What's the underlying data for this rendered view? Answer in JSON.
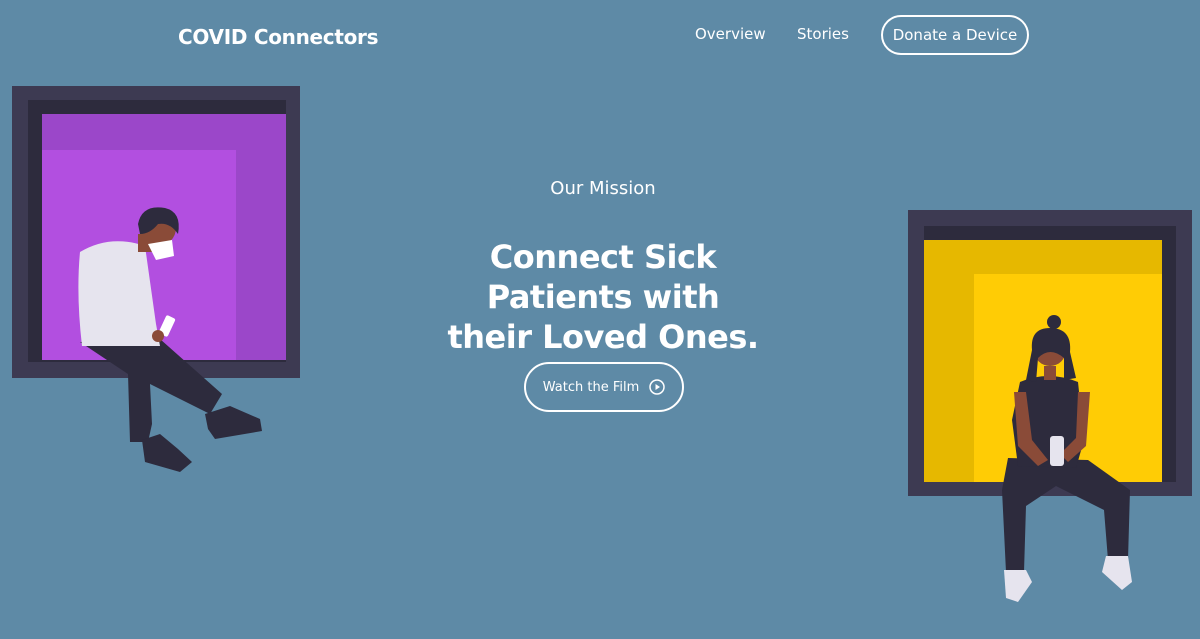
{
  "header": {
    "brand": "COVID Connectors",
    "nav": [
      {
        "label": "Overview"
      },
      {
        "label": "Stories"
      }
    ],
    "cta": "Donate a Device"
  },
  "hero": {
    "eyebrow": "Our Mission",
    "headline_lines": [
      "Connect Sick",
      "Patients with",
      "their Loved Ones."
    ],
    "button_label": "Watch the Film",
    "button_icon": "play-circle-icon"
  },
  "colors": {
    "background": "#5e8aa6",
    "window_frame": "#3d3a52",
    "left_window": "#a14fd0",
    "right_window": "#ffcb05",
    "text": "#ffffff"
  }
}
